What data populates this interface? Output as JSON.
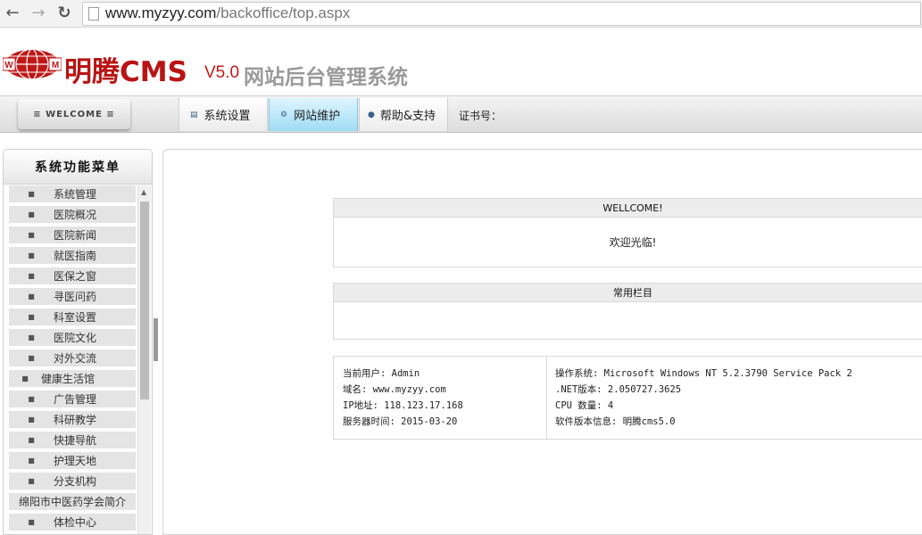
{
  "browser": {
    "back_icon": "back-arrow-icon",
    "forward_icon": "forward-arrow-icon",
    "reload_icon": "reload-icon",
    "url_host": "www.myzyy.com",
    "url_path": "/backoffice/top.aspx"
  },
  "header": {
    "brand": "明腾CMS",
    "version": "V5.0",
    "subtitle": "网站后台管理系统"
  },
  "toolbar": {
    "welcome": "≡ WELCOME ≡",
    "tabs": [
      {
        "label": "系统设置",
        "icon": "monitor-icon"
      },
      {
        "label": "网站维护",
        "icon": "gear-icon"
      },
      {
        "label": "帮助&支持",
        "icon": "person-icon"
      }
    ],
    "license_label": "证书号："
  },
  "sidebar": {
    "title": "系统功能菜单",
    "items": [
      "系统管理",
      "医院概况",
      "医院新闻",
      "就医指南",
      "医保之窗",
      "寻医问药",
      "科室设置",
      "医院文化",
      "对外交流",
      "健康生活馆",
      "广告管理",
      "科研教学",
      "快捷导航",
      "护理天地",
      "分支机构",
      "绵阳市中医药学会简介",
      "体检中心"
    ]
  },
  "main": {
    "welcome_box": {
      "title": "WELLCOME!",
      "body": "欢迎光临!"
    },
    "common_box": {
      "title": "常用栏目"
    },
    "info": {
      "left": [
        "当前用户: Admin",
        "域名: www.myzyy.com",
        "IP地址: 118.123.17.168",
        "服务器时间: 2015-03-20"
      ],
      "right": [
        "操作系统: Microsoft Windows NT 5.2.3790 Service Pack 2",
        ".NET版本: 2.050727.3625",
        "CPU 数量: 4",
        "软件版本信息: 明腾cms5.0"
      ]
    }
  },
  "colors": {
    "brand_red": "#b91414",
    "active_tab": "#9fdcf5",
    "menu_bg": "#e4e4e4"
  }
}
